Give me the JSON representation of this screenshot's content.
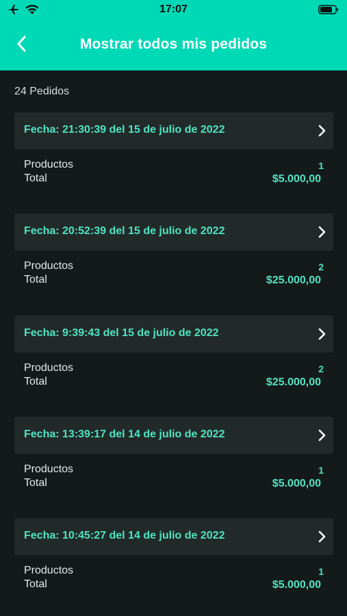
{
  "status": {
    "time": "17:07",
    "icons": [
      "airplane-icon",
      "wifi-icon",
      "battery-icon"
    ]
  },
  "nav": {
    "title": "Mostrar todos mis pedidos",
    "back_icon": "chevron-left-icon"
  },
  "summary": {
    "count_label": "24 Pedidos"
  },
  "labels": {
    "products": "Productos",
    "total": "Total"
  },
  "orders": [
    {
      "date": "Fecha: 21:30:39 del 15 de julio de 2022",
      "products": "1",
      "total": "$5.000,00"
    },
    {
      "date": "Fecha: 20:52:39 del 15 de julio de 2022",
      "products": "2",
      "total": "$25.000,00"
    },
    {
      "date": "Fecha: 9:39:43 del 15 de julio de 2022",
      "products": "2",
      "total": "$25.000,00"
    },
    {
      "date": "Fecha: 13:39:17 del 14 de julio de 2022",
      "products": "1",
      "total": "$5.000,00"
    },
    {
      "date": "Fecha: 10:45:27 del 14 de julio de 2022",
      "products": "1",
      "total": "$5.000,00"
    }
  ],
  "colors": {
    "accent": "#00d9b6",
    "text_accent": "#4fe3c3",
    "background": "#141a1a",
    "card": "#222a29"
  }
}
